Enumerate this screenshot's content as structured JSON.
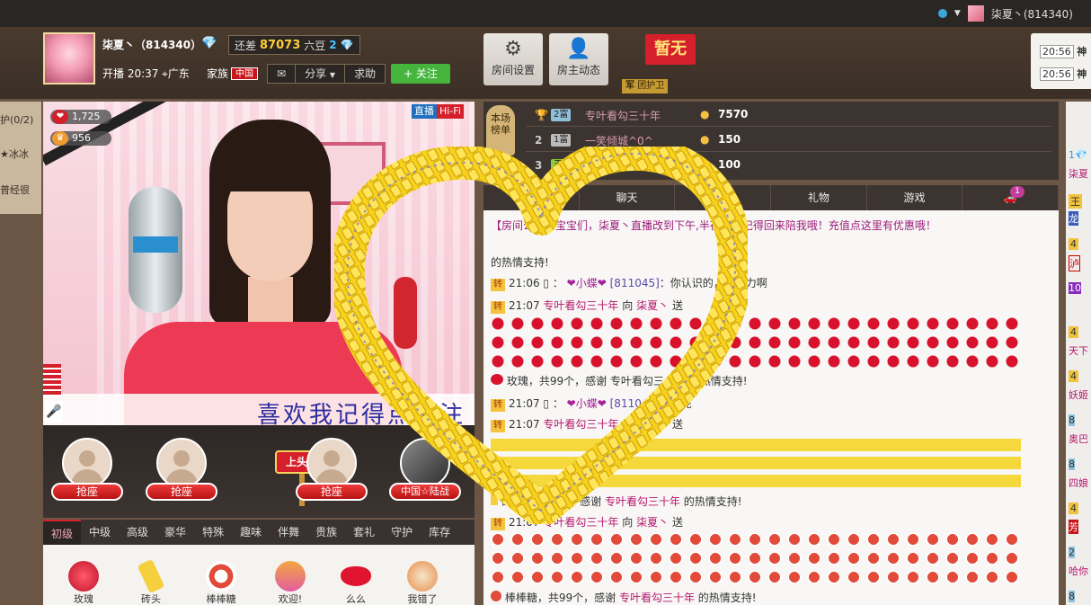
{
  "topbar": {
    "user": "柒夏丶(814340)"
  },
  "header": {
    "host_name": "柒夏丶（814340）",
    "gap_label": "还差",
    "gap_value": "87073",
    "gap_unit": "六豆",
    "gap_level": "2",
    "live_time": "开播 20:37",
    "location": "广东",
    "family_label": "家族",
    "family_tag": "中国",
    "share": "分享",
    "help": "求助",
    "follow": "+ 关注",
    "btn_settings": "房间设置",
    "btn_dynamic": "房主动态",
    "guard_flag": "暂无",
    "guard_label": "团护卫",
    "guard_badge": "军",
    "times": [
      "20:56",
      "20:56"
    ],
    "side_text": [
      "神",
      "神"
    ]
  },
  "left_mini": [
    "护(0/2)",
    "★冰冰",
    "普经很"
  ],
  "video": {
    "likes": "1,725",
    "fans": "956",
    "badge_live": "直播",
    "badge_hifi": "Hi-Fi",
    "scroll_text": "喜欢我记得点关注"
  },
  "seats": [
    {
      "label": "抢座"
    },
    {
      "label": "抢座"
    },
    {
      "label": "抢座"
    },
    {
      "label": "中国☆陆战"
    }
  ],
  "headline": "上头条",
  "gift_tabs": [
    "初级",
    "中级",
    "高级",
    "豪华",
    "特殊",
    "趣味",
    "伴舞",
    "贵族",
    "套礼",
    "守护",
    "库存"
  ],
  "gifts": [
    "玫瑰",
    "砖头",
    "棒棒糖",
    "欢迎!",
    "么么",
    "我错了"
  ],
  "ranking": {
    "tag": "本场榜单",
    "rows": [
      {
        "no": "1",
        "level": "2富",
        "name": "专叶看勾三十年",
        "value": "7570"
      },
      {
        "no": "2",
        "level": "1富",
        "name": "一笑倾城^0^",
        "value": "150"
      },
      {
        "no": "3",
        "level": "王冠",
        "name": "",
        "value": "100"
      }
    ]
  },
  "chat_tabs": [
    "公屏",
    "聊天",
    "点歌",
    "礼物",
    "游戏",
    ""
  ],
  "chat_badge": "1",
  "chat": {
    "notice": "【房间公告】宝宝们，柒夏丶直播改到下午,半夜了，记得回来陪我哦！充值点这里有优惠哦！",
    "thanks0": "的热情支持!",
    "l1_time": "21:06",
    "l1_name": "❤小蝶❤",
    "l1_id": "[811045]",
    "l1_msg": "：你认识的，么给力啊",
    "l2_time": "21:07",
    "l2_user": "专叶看勾三十年",
    "l2_to": "向",
    "l2_host": "柒夏丶",
    "l2_action": "送",
    "rose_summary": "玫瑰，共99个，感谢 专叶看勾三十年 的热情支持!",
    "l3_time": "21:07",
    "l3_name": "❤小蝶❤",
    "l3_id": "[811045]",
    "l3_msg": "：你呢",
    "l4_time": "21:07",
    "l4_user": "专叶看勾三十年",
    "l4_to": "向",
    "l4_host": "柒夏丶",
    "l4_action": "送",
    "brick_pre": "砖头，共99个，感谢",
    "brick_user": "专叶看勾三十年",
    "brick_post": "的热情支持!",
    "l5_time": "21:07",
    "l5_user": "专叶看勾三十年",
    "l5_to": "向",
    "l5_host": "柒夏丶",
    "l5_action": "送",
    "lolly_pre": "棒棒糖，共99个，感谢",
    "lolly_user": "专叶看勾三十年",
    "lolly_post": "的热情支持!"
  },
  "far_right": [
    "1💎",
    "柒夏",
    "王",
    "龙",
    "4",
    "泸",
    "10",
    "4",
    "天下",
    "4",
    "妖姬",
    "8",
    "奥巴",
    "8",
    "四娘",
    "4",
    "芳",
    "2",
    "哈你",
    "8"
  ],
  "colors": {
    "accent": "#d51f2a",
    "follow": "#46b53d",
    "brand": "#ffcf3a"
  }
}
